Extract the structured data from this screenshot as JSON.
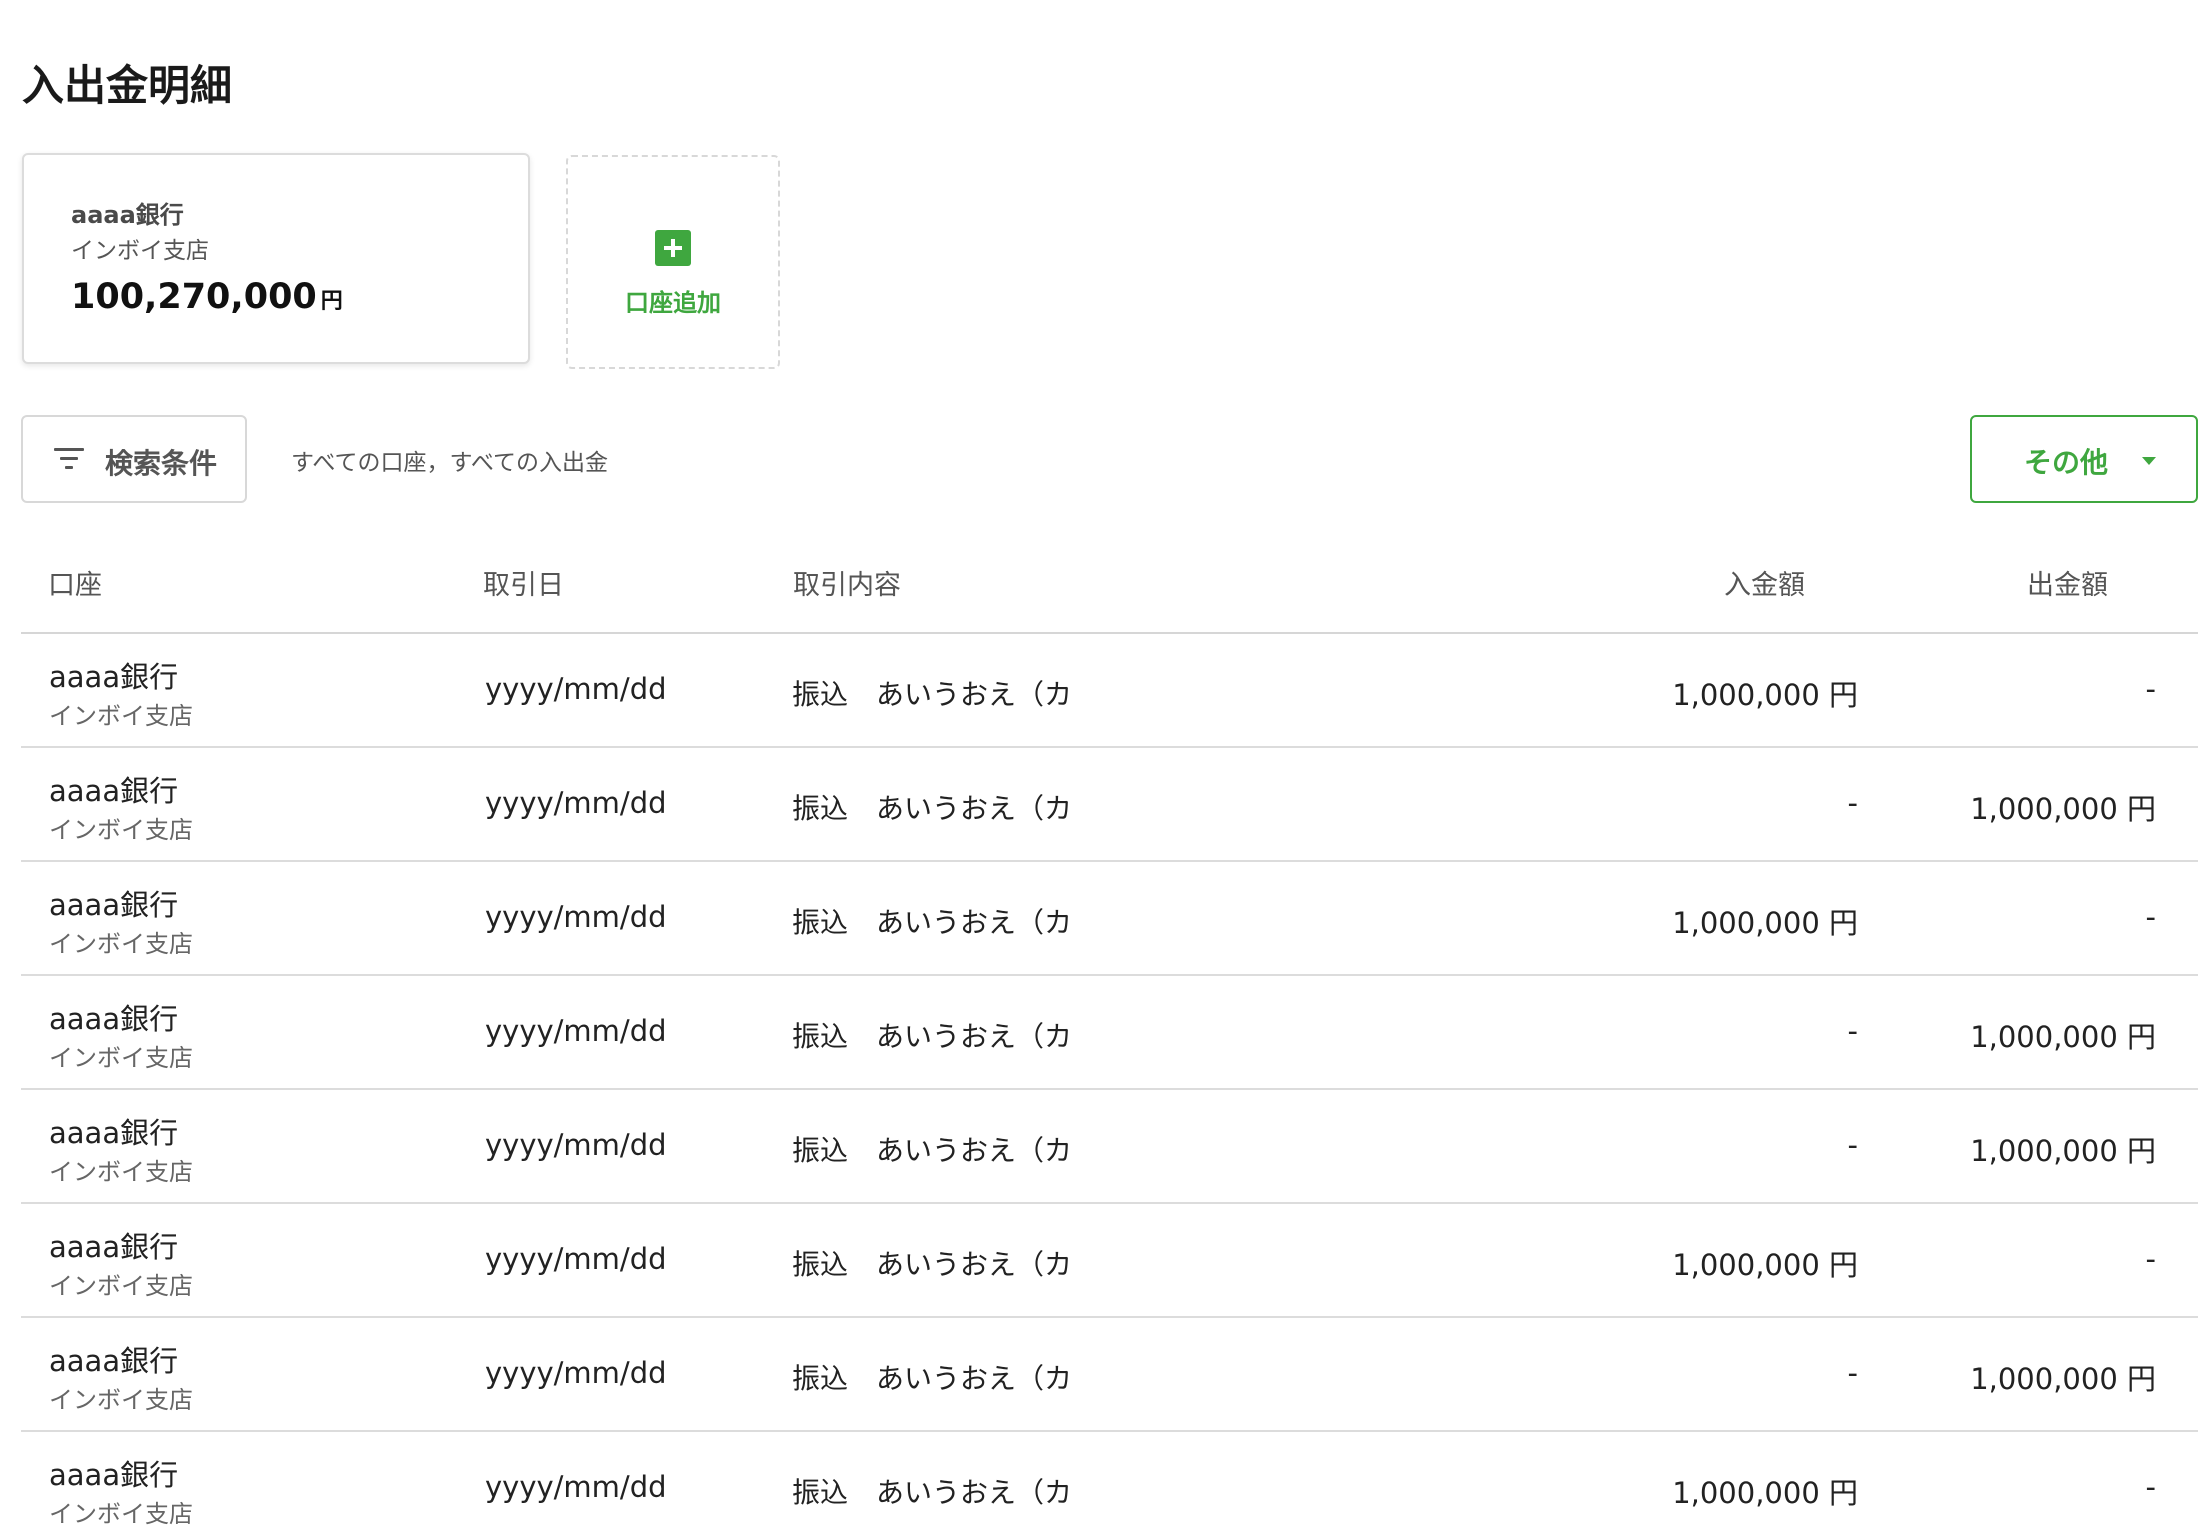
{
  "page": {
    "title": "入出金明細"
  },
  "account_card": {
    "bank": "aaaa銀行",
    "branch": "インボイ支店",
    "balance": "100,270,000",
    "currency": "円"
  },
  "add_account": {
    "label": "口座追加",
    "icon": "plus-icon"
  },
  "filter": {
    "button_label": "検索条件",
    "icon": "filter-icon",
    "summary": "すべての口座，すべての入出金"
  },
  "other": {
    "label": "その他",
    "icon": "caret-down-icon"
  },
  "colors": {
    "accent": "#3fa73f",
    "border": "#d8d8d8",
    "text_muted": "#555555"
  },
  "table": {
    "headers": {
      "account": "口座",
      "date": "取引日",
      "description": "取引内容",
      "deposit": "入金額",
      "withdrawal": "出金額"
    },
    "rows": [
      {
        "bank": "aaaa銀行",
        "branch": "インボイ支店",
        "date": "yyyy/mm/dd",
        "description": "振込　あいうおえ（カ",
        "deposit": "1,000,000 円",
        "withdrawal": "-"
      },
      {
        "bank": "aaaa銀行",
        "branch": "インボイ支店",
        "date": "yyyy/mm/dd",
        "description": "振込　あいうおえ（カ",
        "deposit": "-",
        "withdrawal": "1,000,000 円"
      },
      {
        "bank": "aaaa銀行",
        "branch": "インボイ支店",
        "date": "yyyy/mm/dd",
        "description": "振込　あいうおえ（カ",
        "deposit": "1,000,000 円",
        "withdrawal": "-"
      },
      {
        "bank": "aaaa銀行",
        "branch": "インボイ支店",
        "date": "yyyy/mm/dd",
        "description": "振込　あいうおえ（カ",
        "deposit": "-",
        "withdrawal": "1,000,000 円"
      },
      {
        "bank": "aaaa銀行",
        "branch": "インボイ支店",
        "date": "yyyy/mm/dd",
        "description": "振込　あいうおえ（カ",
        "deposit": "-",
        "withdrawal": "1,000,000 円"
      },
      {
        "bank": "aaaa銀行",
        "branch": "インボイ支店",
        "date": "yyyy/mm/dd",
        "description": "振込　あいうおえ（カ",
        "deposit": "1,000,000 円",
        "withdrawal": "-"
      },
      {
        "bank": "aaaa銀行",
        "branch": "インボイ支店",
        "date": "yyyy/mm/dd",
        "description": "振込　あいうおえ（カ",
        "deposit": "-",
        "withdrawal": "1,000,000 円"
      },
      {
        "bank": "aaaa銀行",
        "branch": "インボイ支店",
        "date": "yyyy/mm/dd",
        "description": "振込　あいうおえ（カ",
        "deposit": "1,000,000 円",
        "withdrawal": "-"
      }
    ]
  }
}
